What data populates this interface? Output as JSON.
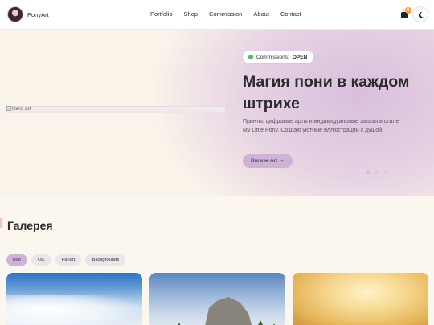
{
  "header": {
    "brand": "PonyArt",
    "nav": [
      "Portfolio",
      "Shop",
      "Commission",
      "About",
      "Contact"
    ],
    "cart_count": "0"
  },
  "hero": {
    "image_alt": "Hero art",
    "status_label": "Commissions:",
    "status_value": "OPEN",
    "title": "Магия пони в каждом штрихе",
    "subtitle": "Принты, цифровые арты и индивидуальные заказы в стиле My Little Pony. Создаю уютные иллюстрации с душой.",
    "cta": "Browse Art →"
  },
  "gallery": {
    "title": "Галерея",
    "filters": [
      "Все",
      "OC",
      "Fanart",
      "Backgrounds"
    ],
    "active_filter": "Все"
  },
  "colors": {
    "accent": "#cfb2d8",
    "status_open": "#3fbf5a",
    "badge": "#f2a33a"
  }
}
